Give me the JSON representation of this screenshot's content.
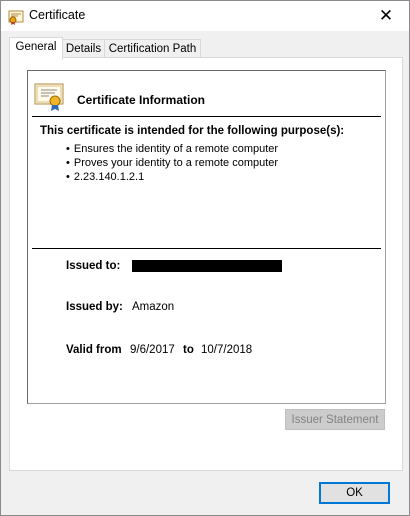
{
  "window": {
    "title": "Certificate",
    "icon": "certificate-icon",
    "close_glyph": "✕"
  },
  "tabs": [
    {
      "label": "General",
      "active": true
    },
    {
      "label": "Details",
      "active": false
    },
    {
      "label": "Certification Path",
      "active": false
    }
  ],
  "general": {
    "info_title": "Certificate Information",
    "purpose_heading": "This certificate is intended for the following purpose(s):",
    "purposes": [
      "Ensures the identity of a remote computer",
      "Proves your identity to a remote computer",
      "2.23.140.1.2.1"
    ],
    "issued_to_label": "Issued to:",
    "issued_to_value": "",
    "issued_by_label": "Issued by:",
    "issued_by_value": "Amazon",
    "valid_from_label": "Valid from",
    "valid_from_value": "9/6/2017",
    "valid_to_label": "to",
    "valid_to_value": "10/7/2018"
  },
  "buttons": {
    "issuer_statement": "Issuer Statement",
    "ok": "OK"
  },
  "colors": {
    "accent": "#0078d7",
    "window_bg": "#f0f0f0"
  }
}
